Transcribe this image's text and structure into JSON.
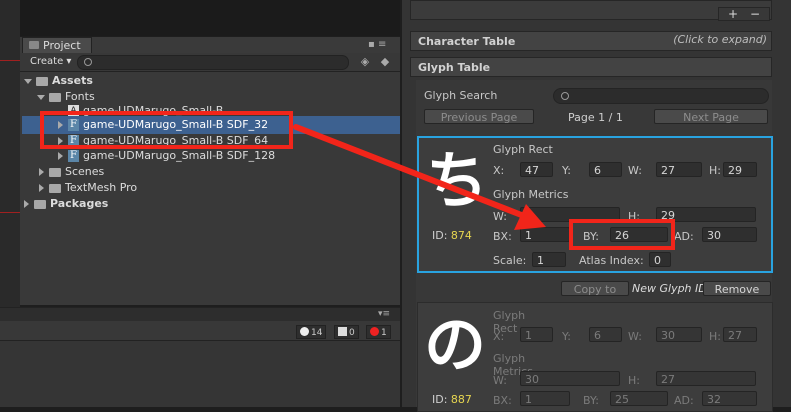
{
  "project": {
    "tab_label": "Project",
    "create_label": "Create",
    "tree": {
      "assets": "Assets",
      "fonts": "Fonts",
      "items": [
        "game-UDMarugo_Small-B",
        "game-UDMarugo_Small-B SDF_32",
        "game-UDMarugo_Small-B SDF_64",
        "game-UDMarugo_Small-B SDF_128"
      ],
      "scenes": "Scenes",
      "textmesh": "TextMesh Pro",
      "packages": "Packages"
    }
  },
  "console": {
    "warn_count": "14",
    "info_count": "0",
    "error_count": "1"
  },
  "inspector": {
    "char_table": "Character Table",
    "click_hint": "(Click to expand)",
    "glyph_table": "Glyph Table",
    "glyph_search": "Glyph Search",
    "prev_page": "Previous Page",
    "page_indicator": "Page 1 / 1",
    "next_page": "Next Page",
    "glyph_rect": "Glyph Rect",
    "glyph_metrics": "Glyph Metrics",
    "copy_to": "Copy to",
    "new_glyph_id": "New Glyph ID",
    "remove": "Remove",
    "glyph1": {
      "char": "ち",
      "id_label": "ID:",
      "id": "874",
      "x": "47",
      "y": "6",
      "w": "27",
      "h": "29",
      "mw": "",
      "mh": "29",
      "bx": "1",
      "by": "26",
      "ad": "30",
      "scale": "1",
      "atlas": "0",
      "atlas_label": "Atlas Index:",
      "scale_label": "Scale:"
    },
    "glyph2": {
      "char": "の",
      "id_label": "ID:",
      "id": "887",
      "x": "1",
      "y": "6",
      "w": "30",
      "h": "27",
      "mw": "30",
      "mh": "27",
      "bx": "1",
      "by": "25",
      "ad": "32"
    }
  },
  "colors": {
    "highlight": "#29a3e0",
    "annotation": "#f2251a",
    "selection": "#3d6190"
  }
}
